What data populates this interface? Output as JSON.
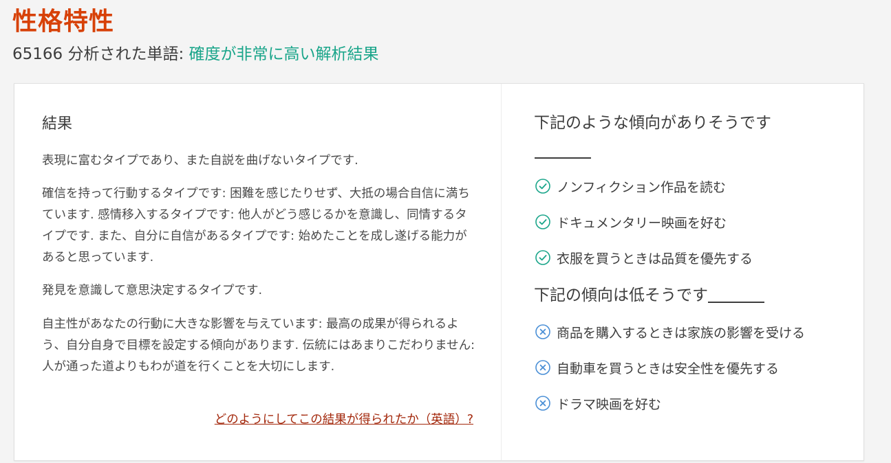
{
  "header": {
    "title": "性格特性",
    "word_count": "65166",
    "analyzed_label": " 分析された単語: ",
    "confidence_text": "確度が非常に高い解析結果"
  },
  "result": {
    "heading": "結果",
    "paragraphs": [
      "表現に富むタイプであり、また自説を曲げないタイプです.",
      "確信を持って行動するタイプです: 困難を感じたりせず、大抵の場合自信に満ちています. 感情移入するタイプです: 他人がどう感じるかを意識し、同情するタイプです. また、自分に自信があるタイプです: 始めたことを成し遂げる能力があると思っています.",
      "発見を意識して意思決定するタイプです.",
      "自主性があなたの行動に大きな影響を与えています: 最高の成果が得られるよう、自分自身で目標を設定する傾向があります. 伝統にはあまりこだわりません: 人が通った道よりもわが道を行くことを大切にします."
    ],
    "how_link": "どのようにしてこの結果が得られたか（英語）?"
  },
  "likely": {
    "heading": "下記のような傾向がありそうです",
    "icon": "check-circle-icon",
    "color": "#1aa58a",
    "items": [
      "ノンフィクション作品を読む",
      "ドキュメンタリー映画を好む",
      "衣服を買うときは品質を優先する"
    ]
  },
  "unlikely": {
    "heading": "下記の傾向は低そうです",
    "icon": "x-circle-icon",
    "color": "#4a8fd6",
    "items": [
      "商品を購入するときは家族の影響を受ける",
      "自動車を買うときは安全性を優先する",
      "ドラマ映画を好む"
    ]
  }
}
